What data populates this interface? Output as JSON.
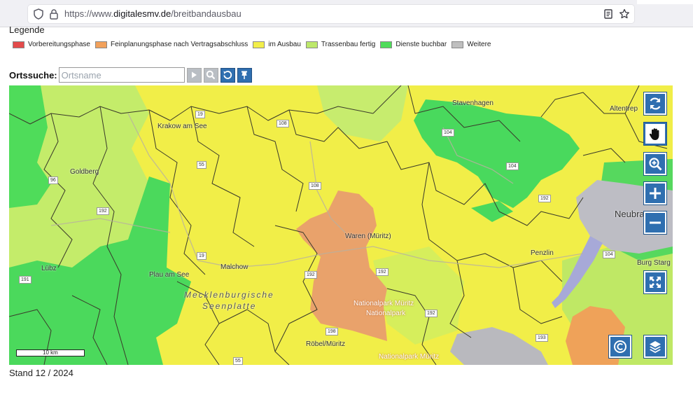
{
  "browser": {
    "url_prefix": "https://www.",
    "url_host": "digitalesmv.de",
    "url_path": "/breitbandausbau",
    "icons": [
      "shield-icon",
      "lock-icon",
      "reader-mode-icon",
      "bookmark-star-icon"
    ]
  },
  "legend": {
    "title": "Legende",
    "items": [
      {
        "label": "Vorbereitungsphase",
        "color": "#e34b4b"
      },
      {
        "label": "Feinplanungsphase nach Vertragsabschluss",
        "color": "#f2a15b"
      },
      {
        "label": "im Ausbau",
        "color": "#f2ee4a"
      },
      {
        "label": "Trassenbau fertig",
        "color": "#bde86a"
      },
      {
        "label": "Dienste buchbar",
        "color": "#4fdc5a"
      },
      {
        "label": "Weitere",
        "color": "#bfbfbf"
      }
    ]
  },
  "search": {
    "label": "Ortssuche:",
    "placeholder": "Ortsname",
    "buttons": [
      "play-icon",
      "search-icon",
      "reset-icon",
      "pin-icon"
    ]
  },
  "map": {
    "places": {
      "krakow": "Krakow am See",
      "goldberg": "Goldberg",
      "luebz": "Lübz",
      "plau": "Plau am See",
      "malchow": "Malchow",
      "waren": "Waren (Müritz)",
      "stavenhagen": "Stavenhagen",
      "altentreptow": "Altentrep",
      "neubrandenburg": "Neubra",
      "penzlin": "Penzlin",
      "burg_stargard": "Burg Starg",
      "roebel": "Röbel/Müritz",
      "region1": "Mecklenburgische",
      "region2": "Seenplatte",
      "park1": "Nationalpark Müritz",
      "park2": "Nationalpark",
      "park3": "Nationalpark Müritz"
    },
    "roads": [
      "19",
      "108",
      "55",
      "104",
      "108",
      "192",
      "19",
      "192",
      "191",
      "104",
      "104",
      "192",
      "198",
      "193",
      "55",
      "96",
      "192",
      "192"
    ],
    "scale_label": "10 km",
    "controls": [
      "refresh-icon",
      "pan-hand-icon",
      "zoom-box-icon",
      "zoom-in-icon",
      "zoom-out-icon",
      "fullscreen-icon",
      "copyright-icon",
      "layers-icon"
    ]
  },
  "footer": {
    "stand": "Stand 12 / 2024"
  }
}
